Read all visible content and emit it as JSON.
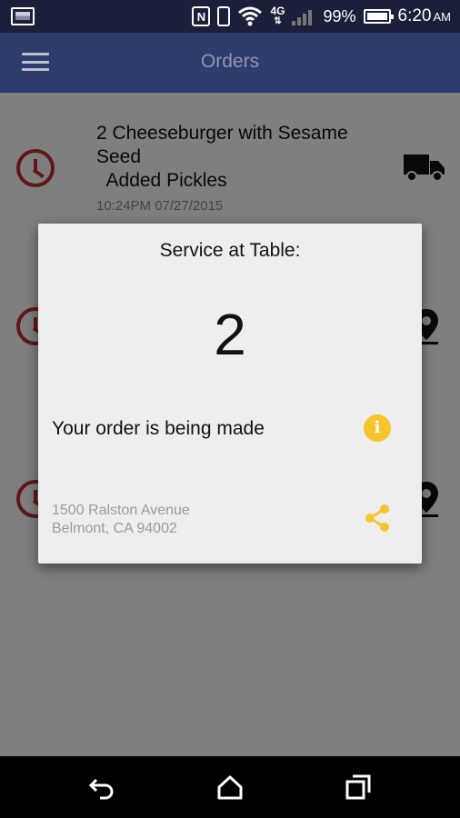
{
  "status_bar": {
    "network": "4G",
    "battery_percent": "99%",
    "time": "6:20",
    "ampm": "AM",
    "icons": [
      "gallery-icon",
      "nfc-icon",
      "vibrate-icon",
      "wifi-icon",
      "4g-icon",
      "signal-icon",
      "battery-icon"
    ]
  },
  "app_bar": {
    "title": "Orders",
    "menu_icon": "hamburger-menu-icon"
  },
  "orders": [
    {
      "item_line1": "2 Cheeseburger with Sesame Seed",
      "item_line2": "  Added Pickles",
      "timestamp": "10:24PM 07/27/2015",
      "status_icon": "clock-icon",
      "delivery_icon": "truck-icon"
    },
    {
      "status_icon": "clock-icon",
      "delivery_icon": "map-pin-icon"
    },
    {
      "status_icon": "clock-icon",
      "delivery_icon": "map-pin-icon"
    }
  ],
  "dialog": {
    "title": "Service at Table:",
    "table_number": "2",
    "status_text": "Your order is being made",
    "status_icon": "info-icon",
    "address_line1": "1500 Ralston Avenue",
    "address_line2": "Belmont, CA 94002",
    "share_icon": "share-icon",
    "accent_color": "#f7c52b"
  },
  "colors": {
    "app_bar": "#2f3c6b",
    "status_bar": "#1b1f3a",
    "clock_red": "#c42e2e"
  },
  "nav_bar": {
    "icons": [
      "back-icon",
      "home-icon",
      "recent-apps-icon"
    ]
  }
}
